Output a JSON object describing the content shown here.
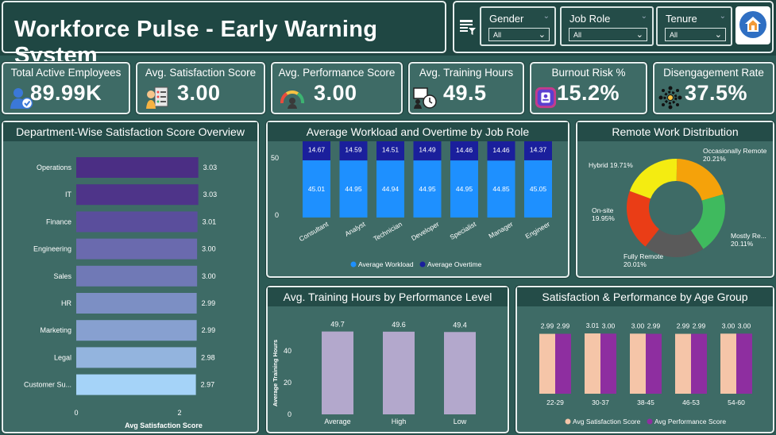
{
  "app": {
    "title": "Workforce Pulse - Early Warning System"
  },
  "filters": [
    {
      "label": "Gender",
      "value": "All"
    },
    {
      "label": "Job Role",
      "value": "All"
    },
    {
      "label": "Tenure",
      "value": "All"
    }
  ],
  "kpis": [
    {
      "label": "Total Active Employees",
      "value": "89.99K",
      "icon": "employee-check-icon"
    },
    {
      "label": "Avg. Satisfaction Score",
      "value": "3.00",
      "icon": "satisfaction-checklist-icon"
    },
    {
      "label": "Avg. Performance Score",
      "value": "3.00",
      "icon": "performance-gauge-icon"
    },
    {
      "label": "Avg. Training Hours",
      "value": "49.5",
      "icon": "training-clock-icon"
    },
    {
      "label": "Burnout Risk %",
      "value": "15.2%",
      "icon": "burnout-icon"
    },
    {
      "label": "Disengagement Rate",
      "value": "37.5%",
      "icon": "network-gear-icon"
    }
  ],
  "colors": {
    "background": "#2c5a55",
    "panel": "#3e6b66",
    "workload": "#1e90ff",
    "overtime": "#1a1f9c",
    "satisfaction_age": "#f5c5a8",
    "performance_age": "#8e2ea0",
    "training_bar": "#b3a8cc"
  },
  "chart_data": [
    {
      "type": "bar",
      "title": "Department-Wise Satisfaction Score Overview",
      "orientation": "horizontal",
      "categories": [
        "Operations",
        "IT",
        "Finance",
        "Engineering",
        "Sales",
        "HR",
        "Marketing",
        "Legal",
        "Customer Su..."
      ],
      "values": [
        3.03,
        3.03,
        3.01,
        3.0,
        3.0,
        2.99,
        2.99,
        2.98,
        2.97
      ],
      "value_labels": [
        "3.03",
        "3.03",
        "3.01",
        "3.00",
        "3.00",
        "2.99",
        "2.99",
        "2.98",
        "2.97"
      ],
      "xlabel": "Avg Satisfaction Score",
      "xticks": [
        "0",
        "2"
      ],
      "xlim": [
        0,
        4.8
      ]
    },
    {
      "type": "bar",
      "title": "Average Workload and Overtime by Job Role",
      "stacked": true,
      "categories": [
        "Consultant",
        "Analyst",
        "Technician",
        "Developer",
        "Specialist",
        "Manager",
        "Engineer"
      ],
      "series": [
        {
          "name": "Average Workload",
          "values": [
            45.01,
            44.95,
            44.94,
            44.95,
            44.95,
            44.85,
            45.05
          ]
        },
        {
          "name": "Average Overtime",
          "values": [
            14.67,
            14.59,
            14.51,
            14.49,
            14.46,
            14.46,
            14.37
          ]
        }
      ],
      "totals": [
        59.68,
        59.54,
        59.45,
        59.44,
        59.42,
        59.32,
        59.42
      ],
      "yticks": [
        "0",
        "50"
      ],
      "ylim": [
        0,
        60
      ]
    },
    {
      "type": "pie",
      "title": "Remote Work Distribution",
      "donut": true,
      "slices": [
        {
          "label": "Occasionally Remote",
          "value": 20.21,
          "text": "20.21%",
          "color": "#f5a20a"
        },
        {
          "label": "Mostly Re...",
          "value": 20.11,
          "text": "20.11%",
          "color": "#3fba5e"
        },
        {
          "label": "Fully Remote",
          "value": 20.01,
          "text": "20.01%",
          "color": "#5a5a5a"
        },
        {
          "label": "On-site",
          "value": 19.95,
          "text": "19.95%",
          "color": "#ea3d16"
        },
        {
          "label": "Hybrid",
          "value": 19.71,
          "text": "19.71%",
          "color": "#f4ec11"
        }
      ]
    },
    {
      "type": "bar",
      "title": "Avg. Training Hours by Performance Level",
      "categories": [
        "Average",
        "High",
        "Low"
      ],
      "values": [
        49.7,
        49.6,
        49.4
      ],
      "value_labels": [
        "49.7",
        "49.6",
        "49.4"
      ],
      "ylabel": "Average Training Hours",
      "yticks": [
        "0",
        "20",
        "40"
      ],
      "ylim": [
        0,
        55
      ]
    },
    {
      "type": "bar",
      "title": "Satisfaction & Performance by Age Group",
      "categories": [
        "22-29",
        "30-37",
        "38-45",
        "46-53",
        "54-60"
      ],
      "series": [
        {
          "name": "Avg Satisfaction Score",
          "values": [
            2.99,
            3.01,
            3.0,
            2.99,
            3.0
          ],
          "labels": [
            "2.99",
            "3.01",
            "3.00",
            "2.99",
            "3.00"
          ]
        },
        {
          "name": "Avg Performance Score",
          "values": [
            2.99,
            3.0,
            2.99,
            2.99,
            3.0
          ],
          "labels": [
            "2.99",
            "3.00",
            "2.99",
            "2.99",
            "3.00"
          ]
        }
      ],
      "ylim": [
        0,
        3.4
      ]
    }
  ]
}
